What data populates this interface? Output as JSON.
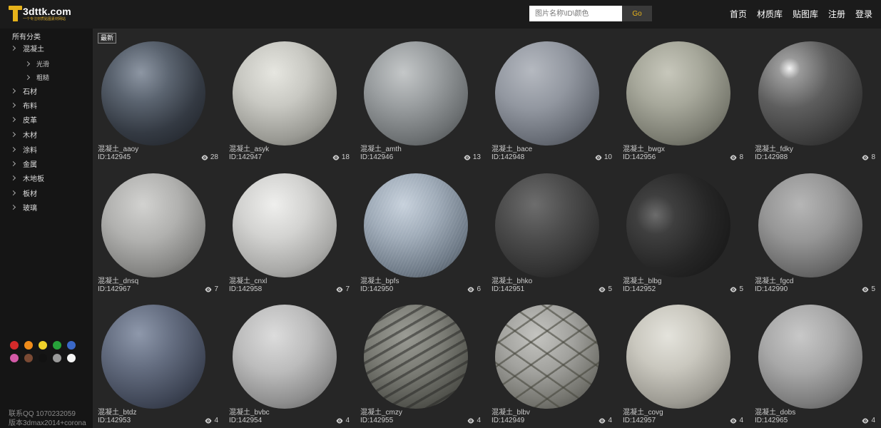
{
  "header": {
    "logo_text": "3dttk.com",
    "logo_subtitle": "一个专注材质贴图素材网站",
    "search_placeholder": "图片名称\\ID\\颜色",
    "search_button": "Go",
    "nav": [
      "首页",
      "材质库",
      "贴图库",
      "注册",
      "登录"
    ]
  },
  "sidebar": {
    "all_categories": "所有分类",
    "categories": [
      {
        "label": "混凝土",
        "level": 0
      },
      {
        "label": "光滑",
        "level": 1
      },
      {
        "label": "粗糙",
        "level": 1
      },
      {
        "label": "石材",
        "level": 0
      },
      {
        "label": "布料",
        "level": 0
      },
      {
        "label": "皮革",
        "level": 0
      },
      {
        "label": "木材",
        "level": 0
      },
      {
        "label": "涂料",
        "level": 0
      },
      {
        "label": "金属",
        "level": 0
      },
      {
        "label": "木地板",
        "level": 0
      },
      {
        "label": "板材",
        "level": 0
      },
      {
        "label": "玻璃",
        "level": 0
      }
    ],
    "colors": [
      "#d42a2a",
      "#f08c1a",
      "#f0d22a",
      "#27a33a",
      "#3a68c8",
      "#d45aa8",
      "#7a4a34",
      "#121212",
      "#9a9a9a",
      "#f5f5f5"
    ],
    "footer_line1": "联系QQ 1070232059",
    "footer_line2": "版本3dmax2014+corona"
  },
  "main": {
    "tag": "最新",
    "items": [
      {
        "name": "混凝土_aaoy",
        "id": "ID:142945",
        "views": "28",
        "tone": "dark-blue"
      },
      {
        "name": "混凝土_asyk",
        "id": "ID:142947",
        "views": "18",
        "tone": "light-smooth"
      },
      {
        "name": "混凝土_amth",
        "id": "ID:142946",
        "views": "13",
        "tone": "mid-grey"
      },
      {
        "name": "混凝土_bace",
        "id": "ID:142948",
        "views": "10",
        "tone": "mottled"
      },
      {
        "name": "混凝土_bwgx",
        "id": "ID:142956",
        "views": "8",
        "tone": "greenish"
      },
      {
        "name": "混凝土_fdky",
        "id": "ID:142988",
        "views": "8",
        "tone": "glossy-dark"
      },
      {
        "name": "混凝土_dnsq",
        "id": "ID:142967",
        "views": "7",
        "tone": "light-mottled"
      },
      {
        "name": "混凝土_cnxl",
        "id": "ID:142958",
        "views": "7",
        "tone": "speckled-white"
      },
      {
        "name": "混凝土_bpfs",
        "id": "ID:142950",
        "views": "6",
        "tone": "brushed-blue"
      },
      {
        "name": "混凝土_bhko",
        "id": "ID:142951",
        "views": "5",
        "tone": "dark-matte"
      },
      {
        "name": "混凝土_blbg",
        "id": "ID:142952",
        "views": "5",
        "tone": "dark-glossy"
      },
      {
        "name": "混凝土_fgcd",
        "id": "ID:142990",
        "views": "5",
        "tone": "grey"
      },
      {
        "name": "混凝土_btdz",
        "id": "ID:142953",
        "views": "4",
        "tone": "blue-slate"
      },
      {
        "name": "混凝土_bvbc",
        "id": "ID:142954",
        "views": "4",
        "tone": "light-grey"
      },
      {
        "name": "混凝土_cmzy",
        "id": "ID:142955",
        "views": "4",
        "tone": "striped"
      },
      {
        "name": "混凝土_blbv",
        "id": "ID:142949",
        "views": "4",
        "tone": "tiled"
      },
      {
        "name": "混凝土_covg",
        "id": "ID:142957",
        "views": "4",
        "tone": "warm-light"
      },
      {
        "name": "混凝土_dobs",
        "id": "ID:142965",
        "views": "4",
        "tone": "soft-grey"
      }
    ]
  }
}
